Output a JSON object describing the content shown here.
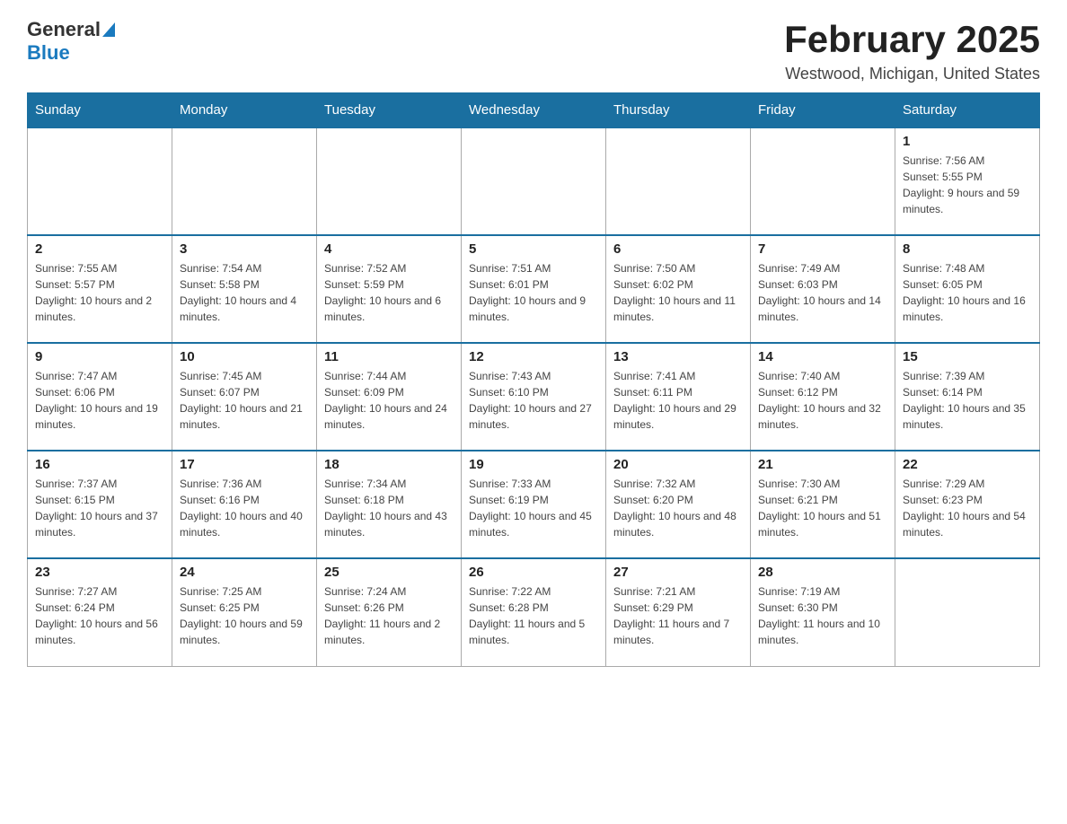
{
  "header": {
    "logo_general": "General",
    "logo_blue": "Blue",
    "month_title": "February 2025",
    "location": "Westwood, Michigan, United States"
  },
  "weekdays": [
    "Sunday",
    "Monday",
    "Tuesday",
    "Wednesday",
    "Thursday",
    "Friday",
    "Saturday"
  ],
  "weeks": [
    [
      {
        "day": "",
        "info": ""
      },
      {
        "day": "",
        "info": ""
      },
      {
        "day": "",
        "info": ""
      },
      {
        "day": "",
        "info": ""
      },
      {
        "day": "",
        "info": ""
      },
      {
        "day": "",
        "info": ""
      },
      {
        "day": "1",
        "info": "Sunrise: 7:56 AM\nSunset: 5:55 PM\nDaylight: 9 hours and 59 minutes."
      }
    ],
    [
      {
        "day": "2",
        "info": "Sunrise: 7:55 AM\nSunset: 5:57 PM\nDaylight: 10 hours and 2 minutes."
      },
      {
        "day": "3",
        "info": "Sunrise: 7:54 AM\nSunset: 5:58 PM\nDaylight: 10 hours and 4 minutes."
      },
      {
        "day": "4",
        "info": "Sunrise: 7:52 AM\nSunset: 5:59 PM\nDaylight: 10 hours and 6 minutes."
      },
      {
        "day": "5",
        "info": "Sunrise: 7:51 AM\nSunset: 6:01 PM\nDaylight: 10 hours and 9 minutes."
      },
      {
        "day": "6",
        "info": "Sunrise: 7:50 AM\nSunset: 6:02 PM\nDaylight: 10 hours and 11 minutes."
      },
      {
        "day": "7",
        "info": "Sunrise: 7:49 AM\nSunset: 6:03 PM\nDaylight: 10 hours and 14 minutes."
      },
      {
        "day": "8",
        "info": "Sunrise: 7:48 AM\nSunset: 6:05 PM\nDaylight: 10 hours and 16 minutes."
      }
    ],
    [
      {
        "day": "9",
        "info": "Sunrise: 7:47 AM\nSunset: 6:06 PM\nDaylight: 10 hours and 19 minutes."
      },
      {
        "day": "10",
        "info": "Sunrise: 7:45 AM\nSunset: 6:07 PM\nDaylight: 10 hours and 21 minutes."
      },
      {
        "day": "11",
        "info": "Sunrise: 7:44 AM\nSunset: 6:09 PM\nDaylight: 10 hours and 24 minutes."
      },
      {
        "day": "12",
        "info": "Sunrise: 7:43 AM\nSunset: 6:10 PM\nDaylight: 10 hours and 27 minutes."
      },
      {
        "day": "13",
        "info": "Sunrise: 7:41 AM\nSunset: 6:11 PM\nDaylight: 10 hours and 29 minutes."
      },
      {
        "day": "14",
        "info": "Sunrise: 7:40 AM\nSunset: 6:12 PM\nDaylight: 10 hours and 32 minutes."
      },
      {
        "day": "15",
        "info": "Sunrise: 7:39 AM\nSunset: 6:14 PM\nDaylight: 10 hours and 35 minutes."
      }
    ],
    [
      {
        "day": "16",
        "info": "Sunrise: 7:37 AM\nSunset: 6:15 PM\nDaylight: 10 hours and 37 minutes."
      },
      {
        "day": "17",
        "info": "Sunrise: 7:36 AM\nSunset: 6:16 PM\nDaylight: 10 hours and 40 minutes."
      },
      {
        "day": "18",
        "info": "Sunrise: 7:34 AM\nSunset: 6:18 PM\nDaylight: 10 hours and 43 minutes."
      },
      {
        "day": "19",
        "info": "Sunrise: 7:33 AM\nSunset: 6:19 PM\nDaylight: 10 hours and 45 minutes."
      },
      {
        "day": "20",
        "info": "Sunrise: 7:32 AM\nSunset: 6:20 PM\nDaylight: 10 hours and 48 minutes."
      },
      {
        "day": "21",
        "info": "Sunrise: 7:30 AM\nSunset: 6:21 PM\nDaylight: 10 hours and 51 minutes."
      },
      {
        "day": "22",
        "info": "Sunrise: 7:29 AM\nSunset: 6:23 PM\nDaylight: 10 hours and 54 minutes."
      }
    ],
    [
      {
        "day": "23",
        "info": "Sunrise: 7:27 AM\nSunset: 6:24 PM\nDaylight: 10 hours and 56 minutes."
      },
      {
        "day": "24",
        "info": "Sunrise: 7:25 AM\nSunset: 6:25 PM\nDaylight: 10 hours and 59 minutes."
      },
      {
        "day": "25",
        "info": "Sunrise: 7:24 AM\nSunset: 6:26 PM\nDaylight: 11 hours and 2 minutes."
      },
      {
        "day": "26",
        "info": "Sunrise: 7:22 AM\nSunset: 6:28 PM\nDaylight: 11 hours and 5 minutes."
      },
      {
        "day": "27",
        "info": "Sunrise: 7:21 AM\nSunset: 6:29 PM\nDaylight: 11 hours and 7 minutes."
      },
      {
        "day": "28",
        "info": "Sunrise: 7:19 AM\nSunset: 6:30 PM\nDaylight: 11 hours and 10 minutes."
      },
      {
        "day": "",
        "info": ""
      }
    ]
  ]
}
